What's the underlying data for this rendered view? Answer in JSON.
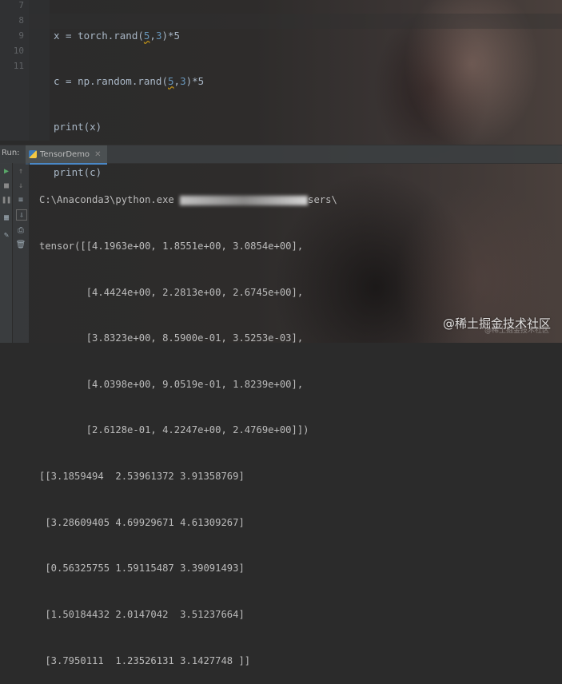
{
  "editor": {
    "line_numbers": [
      "7",
      "8",
      "9",
      "10",
      "11"
    ],
    "lines": [
      {
        "pre": "x = torch.rand(",
        "a": "5",
        "sep": ",",
        "b": "3",
        "post": ")*5"
      },
      {
        "pre": "c = np.random.rand(",
        "a": "5",
        "sep": ",",
        "b": "3",
        "post": ")*5"
      },
      {
        "text": "print(x)"
      },
      {
        "text": "print(c)"
      }
    ]
  },
  "run_panel": {
    "label": "Run:",
    "tab_name": "TensorDemo",
    "tab_icon": "python-file-icon"
  },
  "toolbar": {
    "icons": [
      "run-icon",
      "stop-icon",
      "pause-icon",
      "layout-icon",
      "pin-icon",
      "up-arrow-icon",
      "down-arrow-icon",
      "soft-wrap-icon",
      "scroll-to-end-icon",
      "print-icon",
      "trash-icon"
    ]
  },
  "console": {
    "command": "C:\\Anaconda3\\python.exe ",
    "command_tail": "sers\\",
    "output": [
      "tensor([[4.1963e+00, 1.8551e+00, 3.0854e+00],",
      "        [4.4424e+00, 2.2813e+00, 2.6745e+00],",
      "        [3.8323e+00, 8.5900e-01, 3.5253e-03],",
      "        [4.0398e+00, 9.0519e-01, 1.8239e+00],",
      "        [2.6128e-01, 4.2247e+00, 2.4769e+00]])",
      "[[3.1859494  2.53961372 3.91358769]",
      " [3.28609405 4.69929671 4.61309267]",
      " [0.56325755 1.59115487 3.39091493]",
      " [1.50184432 2.0147042  3.51237664]",
      " [3.7950111  1.23526131 3.1427748 ]]"
    ]
  },
  "watermark": {
    "main": "@稀土掘金技术社区",
    "sub": "@稀土掘金技术社区"
  },
  "colors": {
    "accent": "#4a88c7",
    "number": "#6897bb",
    "text": "#a9b7c6",
    "run_green": "#59a869"
  }
}
